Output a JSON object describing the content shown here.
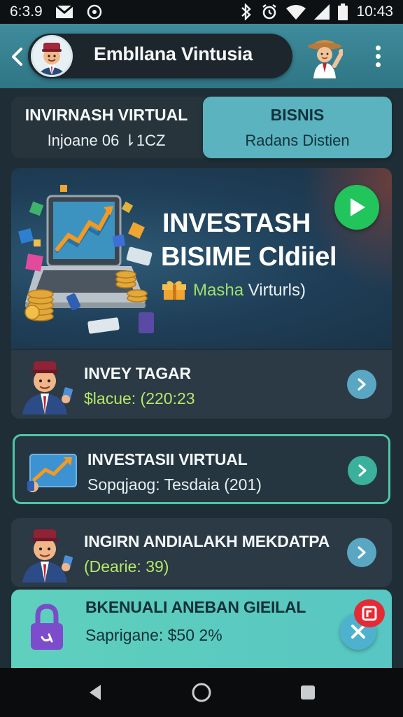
{
  "status_bar": {
    "time_left": "6:3.9",
    "time_right": "10:43",
    "icons": [
      "mail-icon",
      "circle-status-icon",
      "bluetooth-icon",
      "alarm-icon",
      "wifi-icon",
      "signal-icon",
      "battery-icon"
    ]
  },
  "header": {
    "title": "Embllana Vintusia",
    "icons": [
      "back-icon",
      "avatar",
      "mascot",
      "more-vert-icon"
    ]
  },
  "tabs": [
    {
      "title": "INVIRNASH VIRTUAL",
      "subtitle": "Injoane 06 ⇂1CZ",
      "active": false
    },
    {
      "title": "BISNIS",
      "subtitle": "Radans Distien",
      "active": true
    }
  ],
  "banner": {
    "title_line1": "INVESTASH",
    "title_line2": "BISIME Cldiiel",
    "subtitle_prefix": "Masha",
    "subtitle_rest": " Virturls)",
    "icons": [
      "laptop-growth-illustration",
      "gift-icon",
      "play-icon"
    ],
    "colors": {
      "play": "#22c45c",
      "highlight": "#9fe06a"
    }
  },
  "list": [
    {
      "title": "INVEY TAGAR",
      "subtitle": "$lacue: (220:23",
      "icon": "investor-avatar",
      "subtitle_color": "#b5e86a"
    },
    {
      "title": "INVESTASII VIRTUAL",
      "subtitle": "Sopqjaog: Tesdaia (201)",
      "icon": "chart-card-icon",
      "selected": true
    },
    {
      "title": "INGIRN ANDIALAKH MEKDATPA",
      "subtitle": "(Dearie: 39)",
      "icon": "investor-avatar",
      "subtitle_color": "#b5e86a"
    },
    {
      "title": "BKENUALI ANEBAN GIEILAL",
      "subtitle": "Saprigane: $50 2%",
      "icon": "lock-icon"
    }
  ],
  "fab": {
    "icons": [
      "close-icon",
      "badge-icon"
    ],
    "badge_color": "#e52a36"
  },
  "nav": {
    "icons": [
      "back-triangle-icon",
      "home-circle-icon",
      "recents-square-icon"
    ]
  }
}
